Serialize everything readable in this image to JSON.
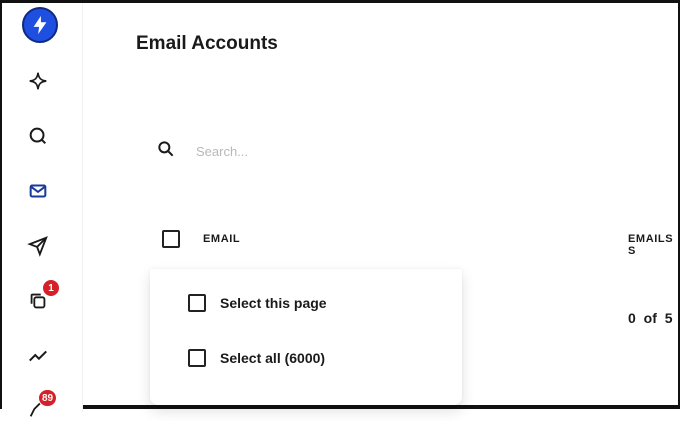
{
  "page": {
    "title": "Email Accounts"
  },
  "sidebar": {
    "items": [
      {
        "icon": "sparkle-icon"
      },
      {
        "icon": "search-icon"
      },
      {
        "icon": "mail-icon",
        "active": true
      },
      {
        "icon": "send-icon"
      },
      {
        "icon": "copy-icon",
        "badge": "1"
      },
      {
        "icon": "analytics-icon"
      },
      {
        "icon": "pen-icon",
        "badge": "89"
      }
    ],
    "accent": "#1e4fe0",
    "badge_color": "#d5202a"
  },
  "search": {
    "placeholder": "Search..."
  },
  "table": {
    "columns": [
      "EMAIL",
      "EMAILS S"
    ],
    "rows": [
      {
        "sent": "0 of 5"
      }
    ]
  },
  "select_menu": {
    "options": [
      "Select this page",
      "Select all (6000)"
    ]
  }
}
